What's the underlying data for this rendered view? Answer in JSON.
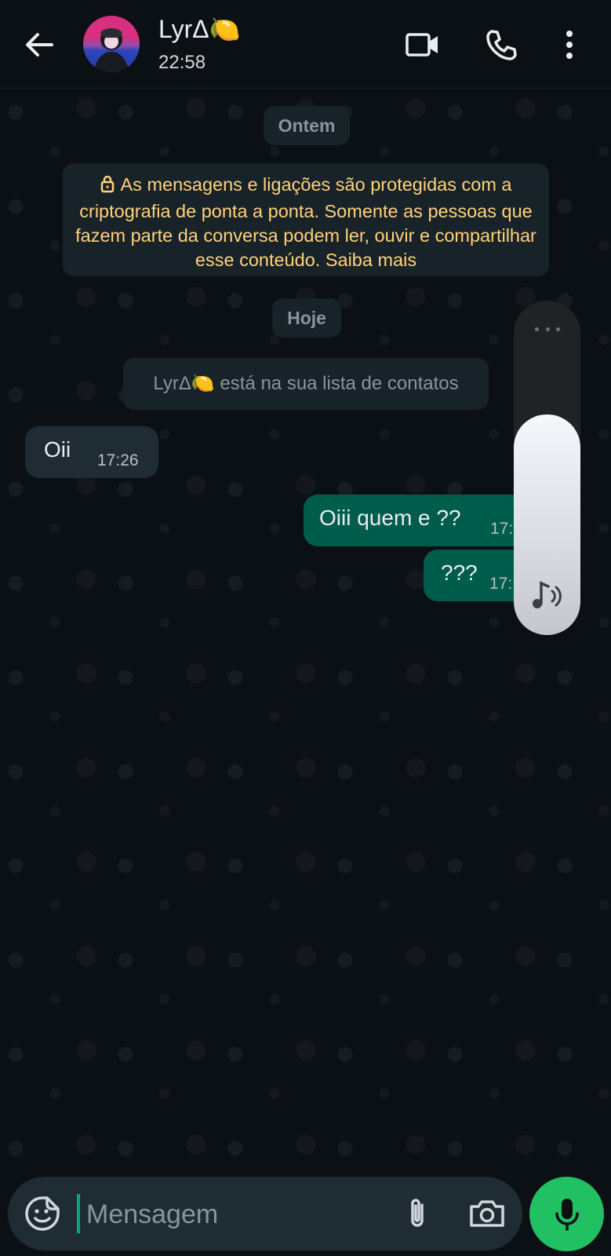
{
  "header": {
    "contact_name": "LyrΔ",
    "contact_emoji": "🍋",
    "status": "22:58",
    "icons": [
      "back-arrow-icon",
      "video-call-icon",
      "phone-call-icon",
      "more-options-icon"
    ]
  },
  "chat": {
    "date_yesterday": "Ontem",
    "encryption_notice": "As mensagens e ligações são protegidas com a criptografia de ponta a ponta. Somente as pessoas que fazem parte da conversa podem ler, ouvir e compartilhar esse conteúdo. Saiba mais",
    "date_today": "Hoje",
    "contact_notice_name": "LyrΔ",
    "contact_notice_text": "está na sua lista de contatos",
    "messages": [
      {
        "direction": "incoming",
        "text": "Oii",
        "time": "17:26"
      },
      {
        "direction": "outgoing",
        "text": "Oiii quem e ??",
        "time": "17:"
      },
      {
        "direction": "outgoing",
        "text": "???",
        "time": "17:"
      }
    ]
  },
  "volume_overlay": {
    "level_fraction": 0.66,
    "icon": "music-volume-icon"
  },
  "input_bar": {
    "placeholder": "Mensagem",
    "value": "",
    "icons": [
      "sticker-emoji-icon",
      "attach-paperclip-icon",
      "camera-icon",
      "microphone-icon"
    ]
  },
  "colors": {
    "background": "#0b1014",
    "incoming_bubble": "#202c33",
    "outgoing_bubble": "#005c4b",
    "encryption_text": "#ffd279",
    "mic_button": "#21c063",
    "caret": "#00a884"
  }
}
